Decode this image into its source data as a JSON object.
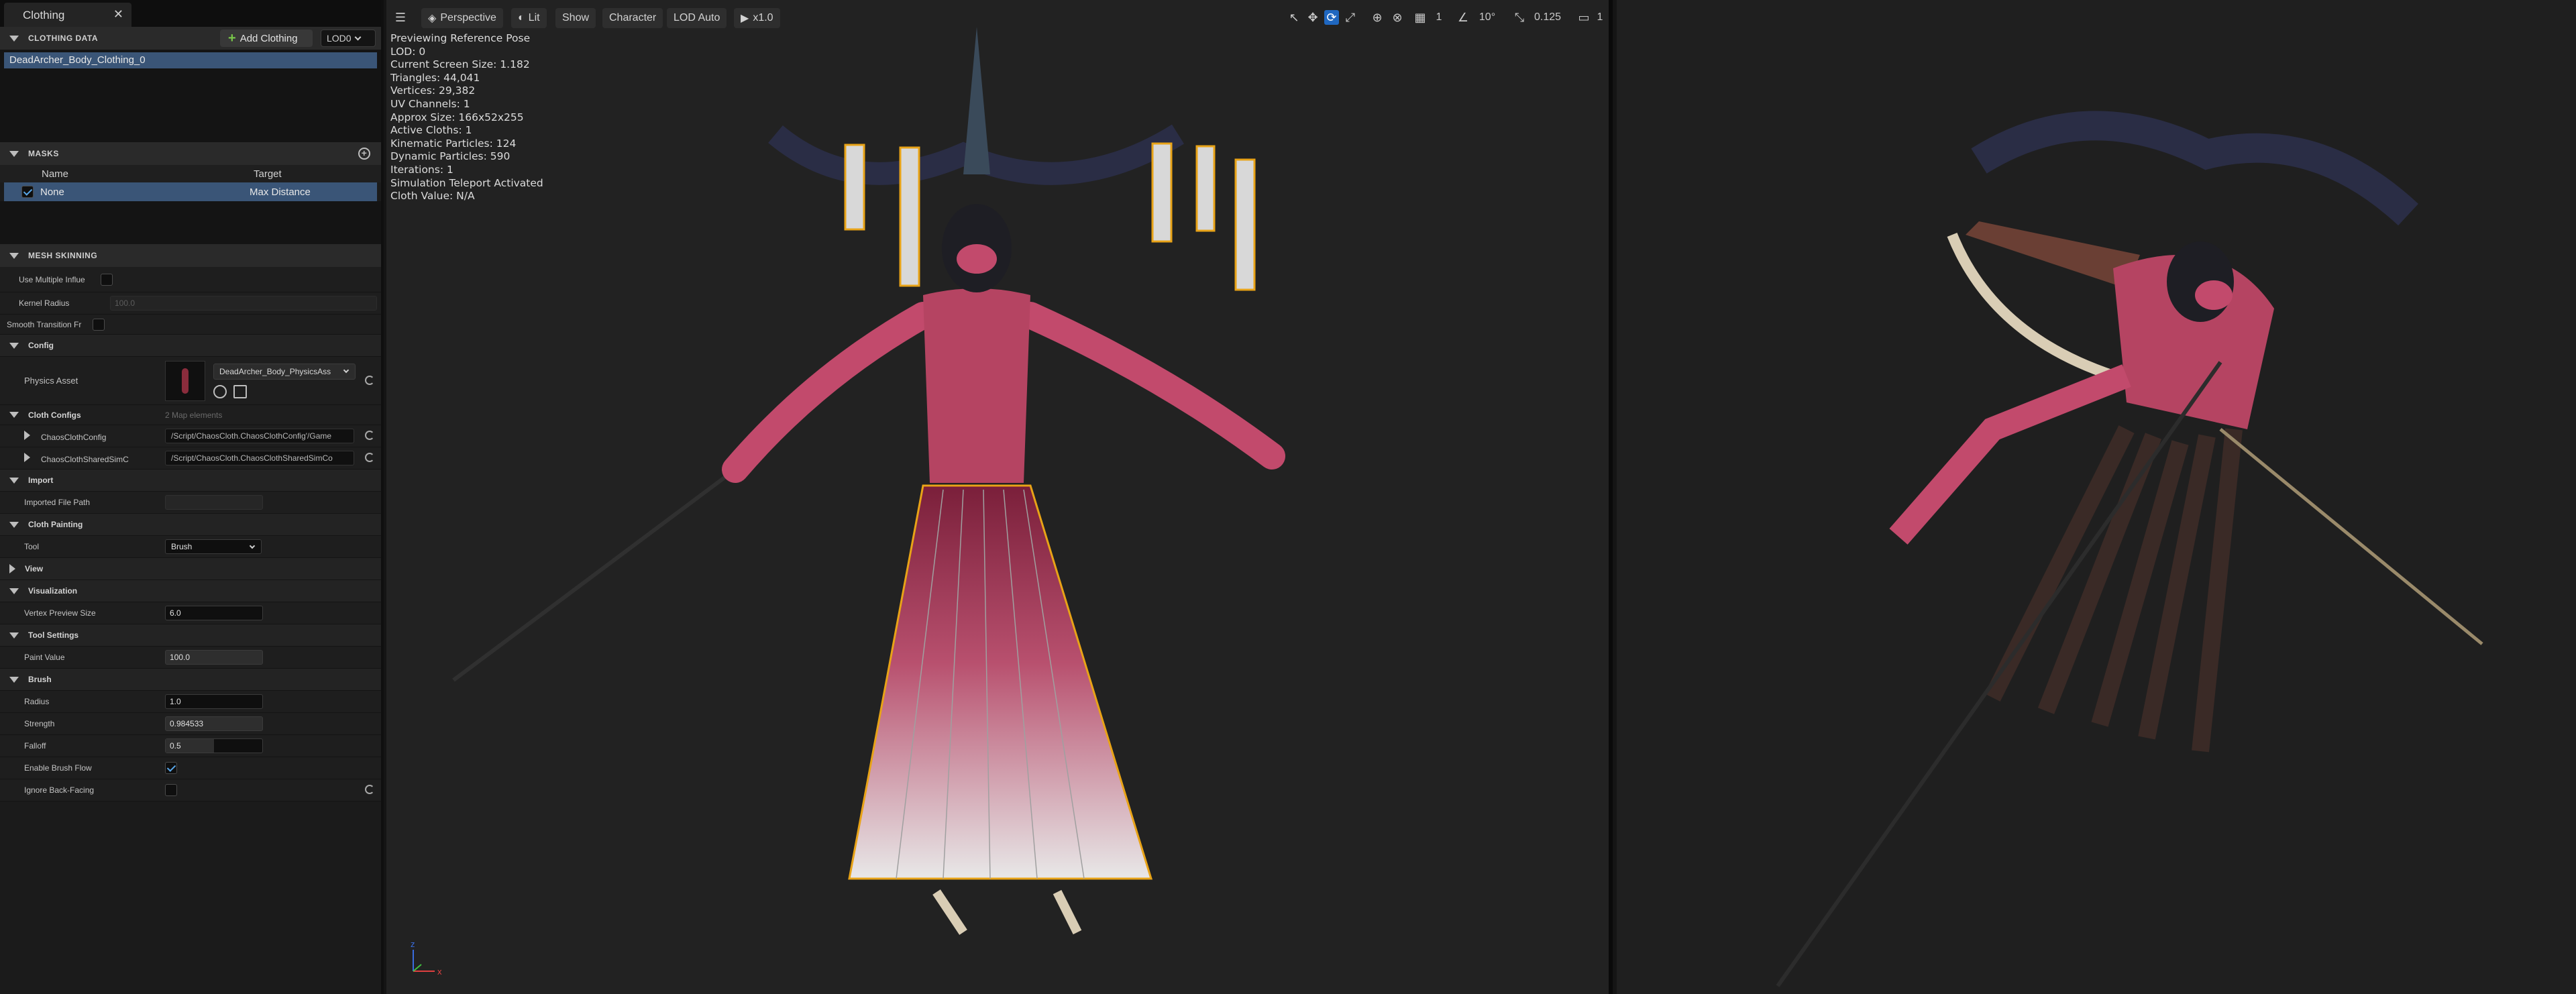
{
  "tab": {
    "title": "Clothing",
    "close": "✕"
  },
  "clothing_data": {
    "header": "CLOTHING DATA",
    "add_button": "Add Clothing",
    "lod": "LOD0",
    "items": [
      "DeadArcher_Body_Clothing_0"
    ]
  },
  "masks": {
    "header": "MASKS",
    "col_name": "Name",
    "col_target": "Target",
    "rows": [
      {
        "name": "None",
        "target": "Max Distance",
        "checked": true
      }
    ]
  },
  "mesh_skinning": {
    "header": "MESH SKINNING",
    "use_multiple_label": "Use Multiple Influe",
    "kernel_radius_label": "Kernel Radius",
    "kernel_radius_value": "100.0",
    "smooth_transition_label": "Smooth Transition Fr"
  },
  "config": {
    "header": "Config",
    "physics_asset_label": "Physics Asset",
    "physics_asset_value": "DeadArcher_Body_PhysicsAss",
    "cloth_configs_label": "Cloth Configs",
    "cloth_configs_count": "2 Map elements",
    "configs": [
      {
        "name": "ChaosClothConfig",
        "path": "/Script/ChaosCloth.ChaosClothConfig'/Game"
      },
      {
        "name": "ChaosClothSharedSimC",
        "path": "/Script/ChaosCloth.ChaosClothSharedSimCo"
      }
    ]
  },
  "import": {
    "header": "Import",
    "file_path_label": "Imported File Path",
    "file_path_value": ""
  },
  "cloth_painting": {
    "header": "Cloth Painting",
    "tool_label": "Tool",
    "tool_value": "Brush"
  },
  "view": {
    "header": "View"
  },
  "visualization": {
    "header": "Visualization",
    "vertex_preview_label": "Vertex Preview Size",
    "vertex_preview_value": "6.0"
  },
  "tool_settings": {
    "header": "Tool Settings",
    "paint_value_label": "Paint Value",
    "paint_value_value": "100.0"
  },
  "brush": {
    "header": "Brush",
    "radius_label": "Radius",
    "radius_value": "1.0",
    "strength_label": "Strength",
    "strength_value": "0.984533",
    "falloff_label": "Falloff",
    "falloff_value": "0.5",
    "falloff_fraction": 0.5,
    "brush_flow_label": "Enable Brush Flow",
    "brush_flow_checked": true,
    "back_facing_label": "Ignore Back-Facing",
    "back_facing_checked": false
  },
  "viewport": {
    "perspective": "Perspective",
    "lit": "Lit",
    "show": "Show",
    "character": "Character",
    "lod": "LOD Auto",
    "play": "x1.0",
    "grid_size": "1",
    "angle": "10°",
    "scale": "0.125",
    "camera_speed": "1",
    "stats": [
      "Previewing Reference Pose",
      "LOD: 0",
      "Current Screen Size: 1.182",
      "Triangles: 44,041",
      "Vertices: 29,382",
      "UV Channels: 1",
      "Approx Size: 166x52x255",
      "Active Cloths: 1",
      "Kinematic Particles: 124",
      "Dynamic Particles: 590",
      "Iterations: 1",
      "Simulation Teleport Activated",
      "Cloth Value: N/A"
    ],
    "axis_z": "z",
    "axis_x": "x"
  },
  "colors": {
    "accent": "#2b5fa0",
    "selection": "#3a5577",
    "highlight": "#e8a317",
    "skin": "#c24a6c"
  }
}
